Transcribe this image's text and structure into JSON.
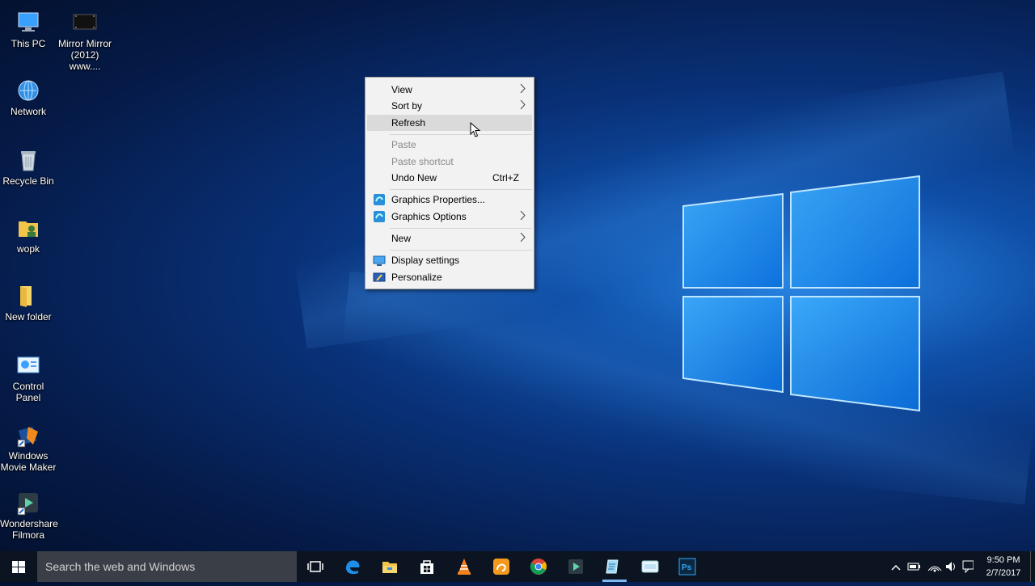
{
  "desktop": {
    "icons": [
      {
        "label": "This PC",
        "icon": "computer-icon"
      },
      {
        "label": "Mirror Mirror (2012) www....",
        "icon": "video-file-icon"
      },
      {
        "label": "Network",
        "icon": "network-icon"
      },
      {
        "label": "Recycle Bin",
        "icon": "recycle-bin-icon"
      },
      {
        "label": "wopk",
        "icon": "user-folder-icon"
      },
      {
        "label": "New folder",
        "icon": "folder-icon"
      },
      {
        "label": "Control Panel",
        "icon": "control-panel-icon"
      },
      {
        "label": "Windows Movie Maker",
        "icon": "movie-maker-icon"
      },
      {
        "label": "Wondershare Filmora",
        "icon": "filmora-icon"
      }
    ]
  },
  "context_menu": {
    "view": "View",
    "sort_by": "Sort by",
    "refresh": "Refresh",
    "paste": "Paste",
    "paste_shortcut": "Paste shortcut",
    "undo_new": "Undo New",
    "undo_new_shortcut": "Ctrl+Z",
    "graphics_properties": "Graphics Properties...",
    "graphics_options": "Graphics Options",
    "new": "New",
    "display_settings": "Display settings",
    "personalize": "Personalize"
  },
  "taskbar": {
    "search_placeholder": "Search the web and Windows",
    "time": "9:50 PM",
    "date": "2/7/2017",
    "pinned": [
      "task-view-icon",
      "edge-icon",
      "file-explorer-icon",
      "store-icon",
      "vlc-icon",
      "uc-browser-icon",
      "chrome-icon",
      "filmora-icon",
      "notepad-icon",
      "app-icon",
      "photoshop-icon"
    ]
  },
  "colors": {
    "accent": "#1e90ff",
    "menu_bg": "#f2f2f2",
    "taskbar_bg": "#0b1420"
  }
}
